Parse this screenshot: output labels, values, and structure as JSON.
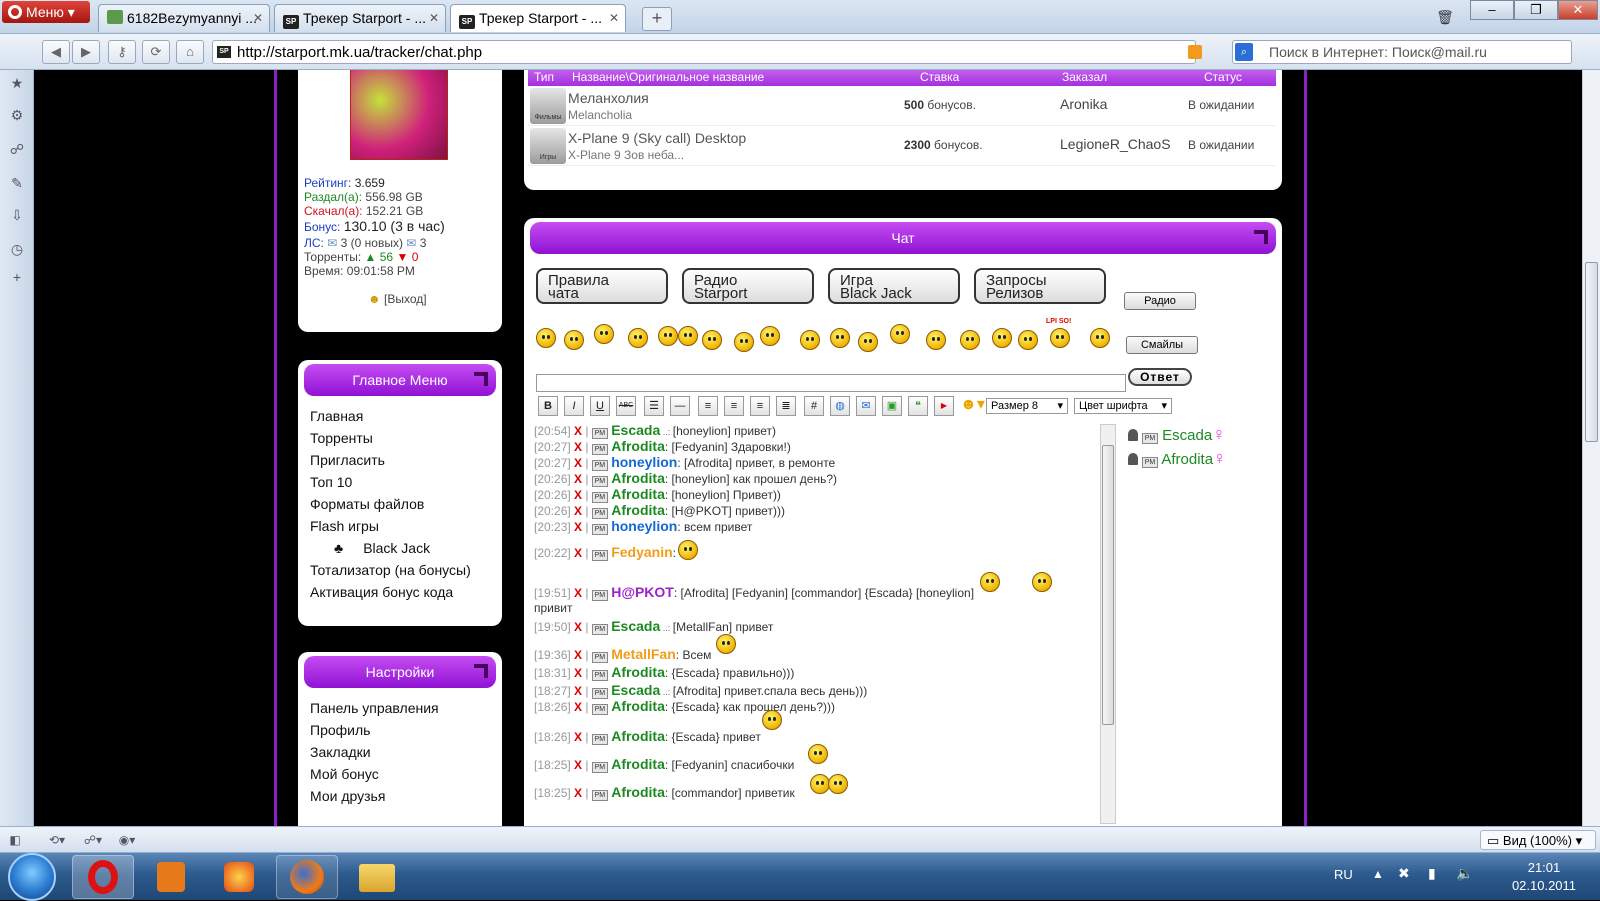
{
  "browser": {
    "menu_label": "Меню",
    "tabs": [
      {
        "title": "6182Bezymyannyi ..."
      },
      {
        "title": "Трекер Starport - ..."
      },
      {
        "title": "Трекер Starport - ..."
      }
    ],
    "url": "http://starport.mk.ua/tracker/chat.php",
    "search_placeholder": "Поиск в Интернет: Поиск@mail.ru",
    "zoom_label": "Вид (100%)"
  },
  "user": {
    "rating_label": "Рейтинг:",
    "rating": "3.659",
    "uploaded_label": "Раздал(а):",
    "uploaded": "556.98 GB",
    "downloaded_label": "Скачал(а):",
    "downloaded": "152.21 GB",
    "bonus_label": "Бонус:",
    "bonus": "130.10 (3 в час)",
    "pm_label": "ЛС:",
    "pm_in": "3 (0 новых)",
    "pm_out": "3",
    "torrents_label": "Торренты:",
    "seeding": "56",
    "leeching": "0",
    "time_label": "Время:",
    "time": "09:01:58 PM",
    "logout": "[Выход]"
  },
  "main_menu": {
    "title": "Главное Меню",
    "items": [
      "Главная",
      "Торренты",
      "Пригласить",
      "Топ 10",
      "Форматы файлов",
      "Flash игры",
      "Black Jack",
      "Тотализатор (на бонусы)",
      "Активация бонус кода"
    ]
  },
  "settings_menu": {
    "title": "Настройки",
    "items": [
      "Панель управления",
      "Профиль",
      "Закладки",
      "Мой бонус",
      "Мои друзья"
    ]
  },
  "requests": {
    "headers": {
      "type": "Тип",
      "name": "Название\\Оригинальное название",
      "bid": "Ставка",
      "ordered": "Заказал",
      "status": "Статус"
    },
    "rows": [
      {
        "cat": "Фильмы",
        "name": "Меланхолия",
        "orig": "Melancholia",
        "bid": "500",
        "bid_unit": "бонусов.",
        "by": "Aronika",
        "status": "В ожидании"
      },
      {
        "cat": "Игры",
        "name": "X-Plane 9 (Sky call) Desktop",
        "orig": "X-Plane 9 Зов неба...",
        "bid": "2300",
        "bid_unit": "бонусов.",
        "by": "LegioneR_ChaoS",
        "status": "В ожидании"
      }
    ]
  },
  "chat": {
    "title": "Чат",
    "buttons": [
      {
        "l1": "Правила",
        "l2": "чата"
      },
      {
        "l1": "Радио",
        "l2": "Starport"
      },
      {
        "l1": "Игра",
        "l2": "Black Jack"
      },
      {
        "l1": "Запросы",
        "l2": "Релизов"
      }
    ],
    "radio_btn": "Радио",
    "smileys_btn": "Смайлы",
    "smiley_caption": "LPI SO!",
    "reply_btn": "Ответ",
    "toolbar": {
      "bold": "B",
      "italic": "I",
      "underline": "U",
      "strike": "ABC",
      "size": "Размер 8",
      "color": "Цвет шрифта"
    },
    "messages": [
      {
        "time": "[20:54]",
        "nick": "Escada",
        "color": "green",
        "dots": true,
        "text": "[honeylion] привет)"
      },
      {
        "time": "[20:27]",
        "nick": "Afrodita",
        "color": "green",
        "text": "[Fedyanin] Здаровки!)"
      },
      {
        "time": "[20:27]",
        "nick": "honeylion",
        "color": "blue",
        "text": "[Afrodita] привет, в ремонте"
      },
      {
        "time": "[20:26]",
        "nick": "Afrodita",
        "color": "green",
        "text": "[honeylion] как прошел день?)"
      },
      {
        "time": "[20:26]",
        "nick": "Afrodita",
        "color": "green",
        "text": "[honeylion] Привет))"
      },
      {
        "time": "[20:26]",
        "nick": "Afrodita",
        "color": "green",
        "text": "[H@PKOT] привет)))"
      },
      {
        "time": "[20:23]",
        "nick": "honeylion",
        "color": "blue",
        "text": "всем привет"
      },
      {
        "time": "[20:22]",
        "nick": "Fedyanin",
        "color": "orange",
        "text": ""
      },
      {
        "time": "[19:51]",
        "nick": "H@PKOT",
        "color": "purple",
        "text": "[Afrodita] [Fedyanin] [commandor] {Escada} [honeylion]",
        "text2": "привит"
      },
      {
        "time": "[19:50]",
        "nick": "Escada",
        "color": "green",
        "dots": true,
        "text": "[MetallFan] привет"
      },
      {
        "time": "[19:36]",
        "nick": "MetallFan",
        "color": "orange",
        "text": "Всем"
      },
      {
        "time": "[18:31]",
        "nick": "Afrodita",
        "color": "green",
        "text": "{Escada} правильно)))"
      },
      {
        "time": "[18:27]",
        "nick": "Escada",
        "color": "green",
        "dots": true,
        "text": "[Afrodita] привет.спала весь день)))"
      },
      {
        "time": "[18:26]",
        "nick": "Afrodita",
        "color": "green",
        "text": "{Escada} как прошел день?)))"
      },
      {
        "time": "[18:26]",
        "nick": "Afrodita",
        "color": "green",
        "text": "{Escada} привет"
      },
      {
        "time": "[18:25]",
        "nick": "Afrodita",
        "color": "green",
        "text": "[Fedyanin] спасибочки"
      },
      {
        "time": "[18:25]",
        "nick": "Afrodita",
        "color": "green",
        "text": "[commandor] приветик"
      }
    ],
    "online": [
      "Escada",
      "Afrodita"
    ]
  },
  "taskbar": {
    "lang": "RU",
    "time": "21:01",
    "date": "02.10.2011"
  }
}
